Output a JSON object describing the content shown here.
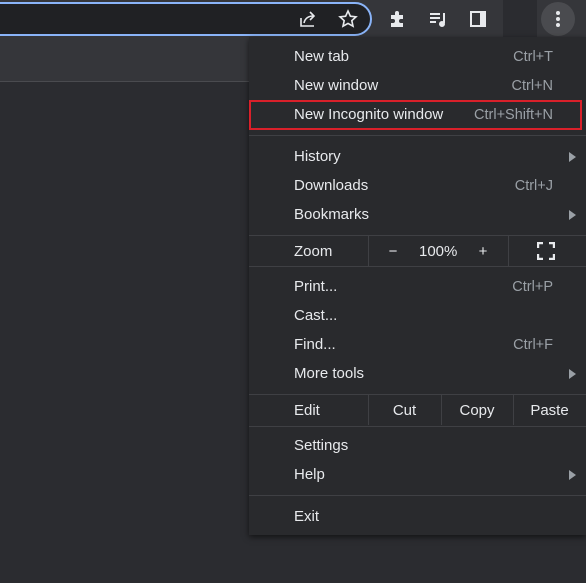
{
  "toolbar": {
    "icons": [
      "share-icon",
      "star-icon",
      "extensions-icon",
      "reading-list-icon",
      "side-panel-icon",
      "more-vert-icon"
    ]
  },
  "menu": {
    "new_tab": {
      "label": "New tab",
      "shortcut": "Ctrl+T"
    },
    "new_window": {
      "label": "New window",
      "shortcut": "Ctrl+N"
    },
    "new_incognito": {
      "label": "New Incognito window",
      "shortcut": "Ctrl+Shift+N",
      "highlight_color": "#d9202a"
    },
    "history": {
      "label": "History"
    },
    "downloads": {
      "label": "Downloads",
      "shortcut": "Ctrl+J"
    },
    "bookmarks": {
      "label": "Bookmarks"
    },
    "zoom": {
      "label": "Zoom",
      "minus": "−",
      "value": "100%",
      "plus": "+"
    },
    "print": {
      "label": "Print...",
      "shortcut": "Ctrl+P"
    },
    "cast": {
      "label": "Cast..."
    },
    "find": {
      "label": "Find...",
      "shortcut": "Ctrl+F"
    },
    "more_tools": {
      "label": "More tools"
    },
    "edit": {
      "label": "Edit",
      "cut": "Cut",
      "copy": "Copy",
      "paste": "Paste"
    },
    "settings": {
      "label": "Settings"
    },
    "help": {
      "label": "Help"
    },
    "exit": {
      "label": "Exit"
    }
  }
}
